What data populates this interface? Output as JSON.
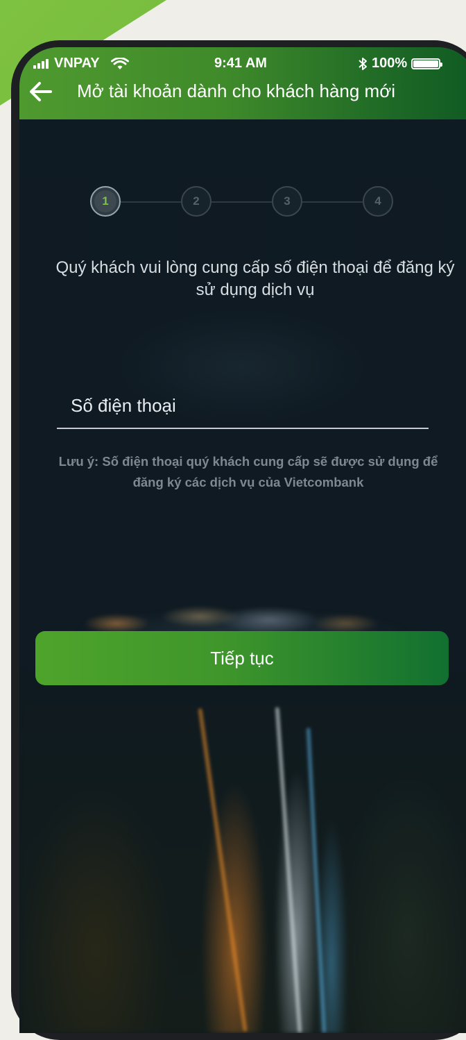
{
  "status_bar": {
    "carrier": "VNPAY",
    "time": "9:41 AM",
    "battery": "100%"
  },
  "header": {
    "title": "Mở tài khoản dành cho khách hàng mới"
  },
  "stepper": {
    "steps": [
      "1",
      "2",
      "3",
      "4"
    ],
    "active_step": 1
  },
  "main": {
    "intro": "Quý khách vui lòng cung cấp số điện thoại để đăng ký sử dụng dịch vụ",
    "phone_placeholder": "Số điện thoại",
    "note": "Lưu ý: Số điện thoại quý khách cung cấp sẽ được sử dụng để đăng ký các dịch vụ của Vietcombank",
    "continue_label": "Tiếp tục"
  },
  "colors": {
    "accent": "#4ea42b",
    "accent_dark": "#117030",
    "background": "#101a22"
  }
}
